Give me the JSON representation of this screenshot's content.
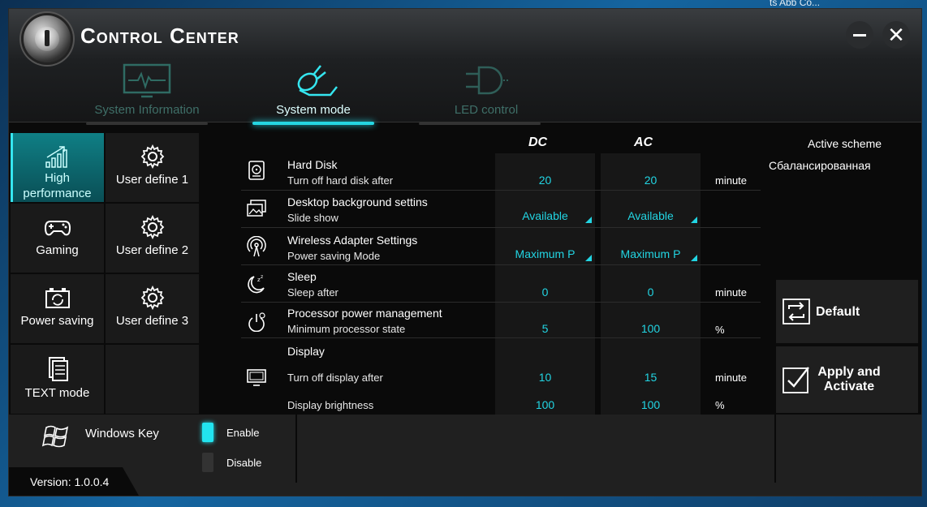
{
  "desktop": {
    "corner_text": "ts Abb Co..."
  },
  "window": {
    "title": "Control Center",
    "minimize_glyph": "—",
    "close_glyph": "✕"
  },
  "tabs": [
    {
      "label": "System Information",
      "icon": "monitor-pulse-icon",
      "active": false
    },
    {
      "label": "System mode",
      "icon": "bulb-plug-icon",
      "active": true
    },
    {
      "label": "LED control",
      "icon": "led-bulb-icon",
      "active": false
    }
  ],
  "modes": [
    {
      "label": "High performance",
      "icon": "signal-bars-icon",
      "active": true
    },
    {
      "label": "User define 1",
      "icon": "gear-icon"
    },
    {
      "label": "Gaming",
      "icon": "gamepad-icon"
    },
    {
      "label": "User define 2",
      "icon": "gear-icon"
    },
    {
      "label": "Power saving",
      "icon": "battery-recycle-icon"
    },
    {
      "label": "User define 3",
      "icon": "gear-icon"
    },
    {
      "label": "TEXT mode",
      "icon": "document-icon"
    }
  ],
  "columns": {
    "dc": "DC",
    "ac": "AC"
  },
  "settings": [
    {
      "name": "Hard Disk",
      "sub": "Turn off hard disk after",
      "dc": "20",
      "ac": "20",
      "unit": "minute",
      "icon": "hard-disk-icon"
    },
    {
      "name": "Desktop background settins",
      "sub": "Slide show",
      "dc": "Available",
      "ac": "Available",
      "unit": "",
      "icon": "slideshow-icon"
    },
    {
      "name": "Wireless Adapter Settings",
      "sub": "Power saving Mode",
      "dc": "Maximum P",
      "ac": "Maximum P",
      "unit": "",
      "icon": "wireless-icon"
    },
    {
      "name": "Sleep",
      "sub": "Sleep after",
      "dc": "0",
      "ac": "0",
      "unit": "minute",
      "icon": "sleep-moon-icon"
    },
    {
      "name": "Processor power management",
      "sub": "Minimum processor state",
      "dc": "5",
      "ac": "100",
      "unit": "%",
      "icon": "processor-power-icon"
    },
    {
      "name": "Display",
      "sub": "Turn off display after",
      "dc": "10",
      "ac": "15",
      "unit": "minute",
      "icon": "display-icon"
    },
    {
      "name": "",
      "sub": "Display brightness",
      "dc": "100",
      "ac": "100",
      "unit": "%"
    }
  ],
  "scheme": {
    "label": "Active scheme",
    "value": "Сбалансированная"
  },
  "actions": {
    "default_label": "Default",
    "apply_line1": "Apply and",
    "apply_line2": "Activate"
  },
  "windows_key": {
    "label": "Windows Key",
    "enable": "Enable",
    "disable": "Disable",
    "enabled": true
  },
  "version": "Version: 1.0.0.4",
  "colors": {
    "accent": "#22d5e3",
    "active_mode": "#0f7f85"
  }
}
